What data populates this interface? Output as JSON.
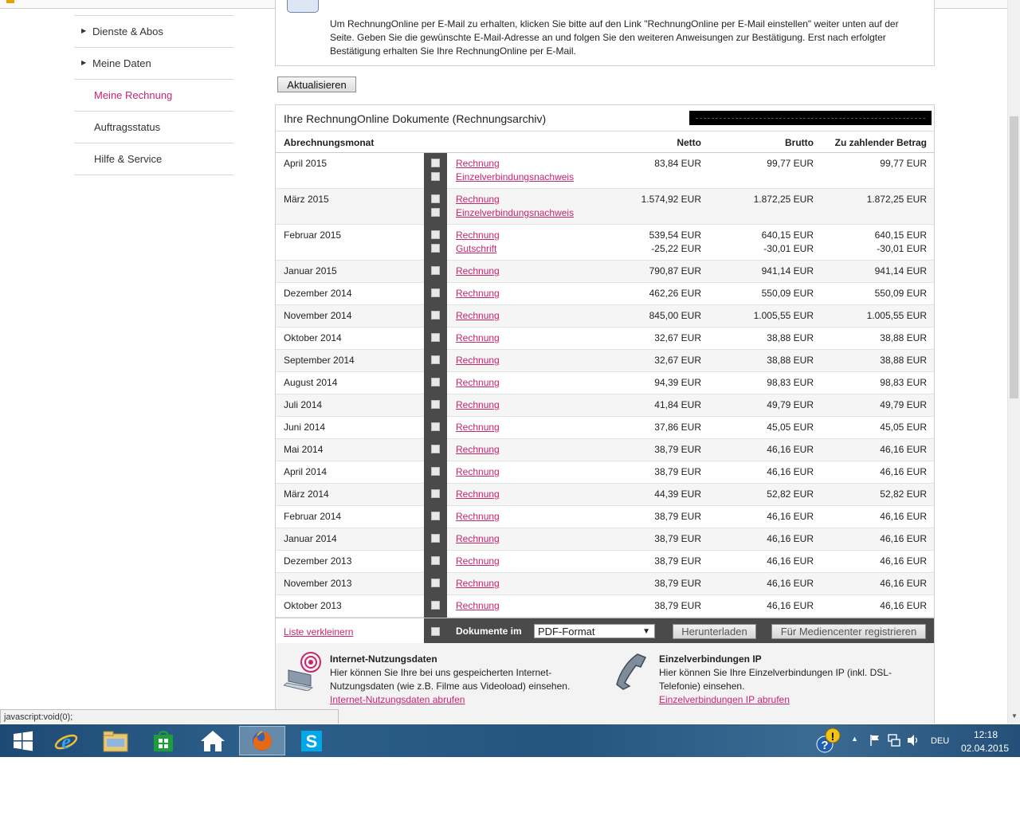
{
  "sidebar": {
    "items": [
      {
        "label": "Dienste & Abos",
        "arrow": "▶"
      },
      {
        "label": "Meine Daten",
        "arrow": "▶"
      },
      {
        "label": "Meine Rechnung"
      },
      {
        "label": "Auftragsstatus"
      },
      {
        "label": "Hilfe & Service"
      }
    ]
  },
  "email_info": {
    "text": "Um RechnungOnline per E-Mail zu erhalten, klicken Sie bitte auf den Link \"RechnungOnline per E-Mail einstellen\" weiter unten auf der Seite. Geben Sie die gewünschte E-Mail-Adresse an und folgen Sie den weiteren Anweisungen zur Bestätigung. Erst nach erfolgter Bestätigung erhalten Sie Ihre RechnungOnline per E-Mail."
  },
  "refresh_label": "Aktualisieren",
  "archive": {
    "title": "Ihre RechnungOnline Dokumente (Rechnungsarchiv)",
    "columns": {
      "month": "Abrechnungsmonat",
      "netto": "Netto",
      "brutto": "Brutto",
      "zahl": "Zu zahlender Betrag"
    },
    "rows": [
      {
        "month": "April 2015",
        "links": [
          "Rechnung",
          "Einzelverbindungsnachweis"
        ],
        "netto": [
          "83,84 EUR"
        ],
        "brutto": [
          "99,77 EUR"
        ],
        "zahl": [
          "99,77 EUR"
        ]
      },
      {
        "month": "März 2015",
        "links": [
          "Rechnung",
          "Einzelverbindungsnachweis"
        ],
        "netto": [
          "1.574,92 EUR"
        ],
        "brutto": [
          "1.872,25 EUR"
        ],
        "zahl": [
          "1.872,25 EUR"
        ]
      },
      {
        "month": "Februar 2015",
        "links": [
          "Rechnung",
          "Gutschrift"
        ],
        "netto": [
          "539,54 EUR",
          "-25,22 EUR"
        ],
        "brutto": [
          "640,15 EUR",
          "-30,01 EUR"
        ],
        "zahl": [
          "640,15 EUR",
          "-30,01 EUR"
        ]
      },
      {
        "month": "Januar 2015",
        "links": [
          "Rechnung"
        ],
        "netto": [
          "790,87 EUR"
        ],
        "brutto": [
          "941,14 EUR"
        ],
        "zahl": [
          "941,14 EUR"
        ]
      },
      {
        "month": "Dezember 2014",
        "links": [
          "Rechnung"
        ],
        "netto": [
          "462,26 EUR"
        ],
        "brutto": [
          "550,09 EUR"
        ],
        "zahl": [
          "550,09 EUR"
        ]
      },
      {
        "month": "November 2014",
        "links": [
          "Rechnung"
        ],
        "netto": [
          "845,00 EUR"
        ],
        "brutto": [
          "1.005,55 EUR"
        ],
        "zahl": [
          "1.005,55 EUR"
        ]
      },
      {
        "month": "Oktober 2014",
        "links": [
          "Rechnung"
        ],
        "netto": [
          "32,67 EUR"
        ],
        "brutto": [
          "38,88 EUR"
        ],
        "zahl": [
          "38,88 EUR"
        ]
      },
      {
        "month": "September 2014",
        "links": [
          "Rechnung"
        ],
        "netto": [
          "32,67 EUR"
        ],
        "brutto": [
          "38,88 EUR"
        ],
        "zahl": [
          "38,88 EUR"
        ]
      },
      {
        "month": "August 2014",
        "links": [
          "Rechnung"
        ],
        "netto": [
          "94,39 EUR"
        ],
        "brutto": [
          "98,83 EUR"
        ],
        "zahl": [
          "98,83 EUR"
        ]
      },
      {
        "month": "Juli 2014",
        "links": [
          "Rechnung"
        ],
        "netto": [
          "41,84 EUR"
        ],
        "brutto": [
          "49,79 EUR"
        ],
        "zahl": [
          "49,79 EUR"
        ]
      },
      {
        "month": "Juni 2014",
        "links": [
          "Rechnung"
        ],
        "netto": [
          "37,86 EUR"
        ],
        "brutto": [
          "45,05 EUR"
        ],
        "zahl": [
          "45,05 EUR"
        ]
      },
      {
        "month": "Mai 2014",
        "links": [
          "Rechnung"
        ],
        "netto": [
          "38,79 EUR"
        ],
        "brutto": [
          "46,16 EUR"
        ],
        "zahl": [
          "46,16 EUR"
        ]
      },
      {
        "month": "April 2014",
        "links": [
          "Rechnung"
        ],
        "netto": [
          "38,79 EUR"
        ],
        "brutto": [
          "46,16 EUR"
        ],
        "zahl": [
          "46,16 EUR"
        ]
      },
      {
        "month": "März 2014",
        "links": [
          "Rechnung"
        ],
        "netto": [
          "44,39 EUR"
        ],
        "brutto": [
          "52,82 EUR"
        ],
        "zahl": [
          "52,82 EUR"
        ]
      },
      {
        "month": "Februar 2014",
        "links": [
          "Rechnung"
        ],
        "netto": [
          "38,79 EUR"
        ],
        "brutto": [
          "46,16 EUR"
        ],
        "zahl": [
          "46,16 EUR"
        ]
      },
      {
        "month": "Januar 2014",
        "links": [
          "Rechnung"
        ],
        "netto": [
          "38,79 EUR"
        ],
        "brutto": [
          "46,16 EUR"
        ],
        "zahl": [
          "46,16 EUR"
        ]
      },
      {
        "month": "Dezember 2013",
        "links": [
          "Rechnung"
        ],
        "netto": [
          "38,79 EUR"
        ],
        "brutto": [
          "46,16 EUR"
        ],
        "zahl": [
          "46,16 EUR"
        ]
      },
      {
        "month": "November 2013",
        "links": [
          "Rechnung"
        ],
        "netto": [
          "38,79 EUR"
        ],
        "brutto": [
          "46,16 EUR"
        ],
        "zahl": [
          "46,16 EUR"
        ]
      },
      {
        "month": "Oktober 2013",
        "links": [
          "Rechnung"
        ],
        "netto": [
          "38,79 EUR"
        ],
        "brutto": [
          "46,16 EUR"
        ],
        "zahl": [
          "46,16 EUR"
        ]
      }
    ],
    "footer": {
      "shrink_label": "Liste verkleinern",
      "docs_label": "Dokumente im",
      "format_selected": "PDF-Format",
      "download_label": "Herunterladen",
      "register_label": "Für Mediencenter registrieren"
    }
  },
  "services": {
    "internet": {
      "title": "Internet-Nutzungsdaten",
      "desc_line1": "Hier können Sie Ihre bei uns gespeicherten Internet-",
      "desc_line2": "Nutzungsdaten (wie z.B. Filme aus Videoload) einsehen.",
      "link": "Internet-Nutzungsdaten abrufen"
    },
    "ip": {
      "title": "Einzelverbindungen IP",
      "desc_line1": "Hier können Sie Ihre Einzelverbindungen IP (inkl. DSL-",
      "desc_line2": "Telefonie) einsehen.",
      "link": "Einzelverbindungen IP abrufen"
    }
  },
  "status_text": "javascript:void(0);",
  "taskbar": {
    "lang": "DEU",
    "time": "12:18",
    "date": "02.04.2015"
  },
  "colors": {
    "accent": "#c8256f",
    "dark_band": "#4a4a4a"
  }
}
